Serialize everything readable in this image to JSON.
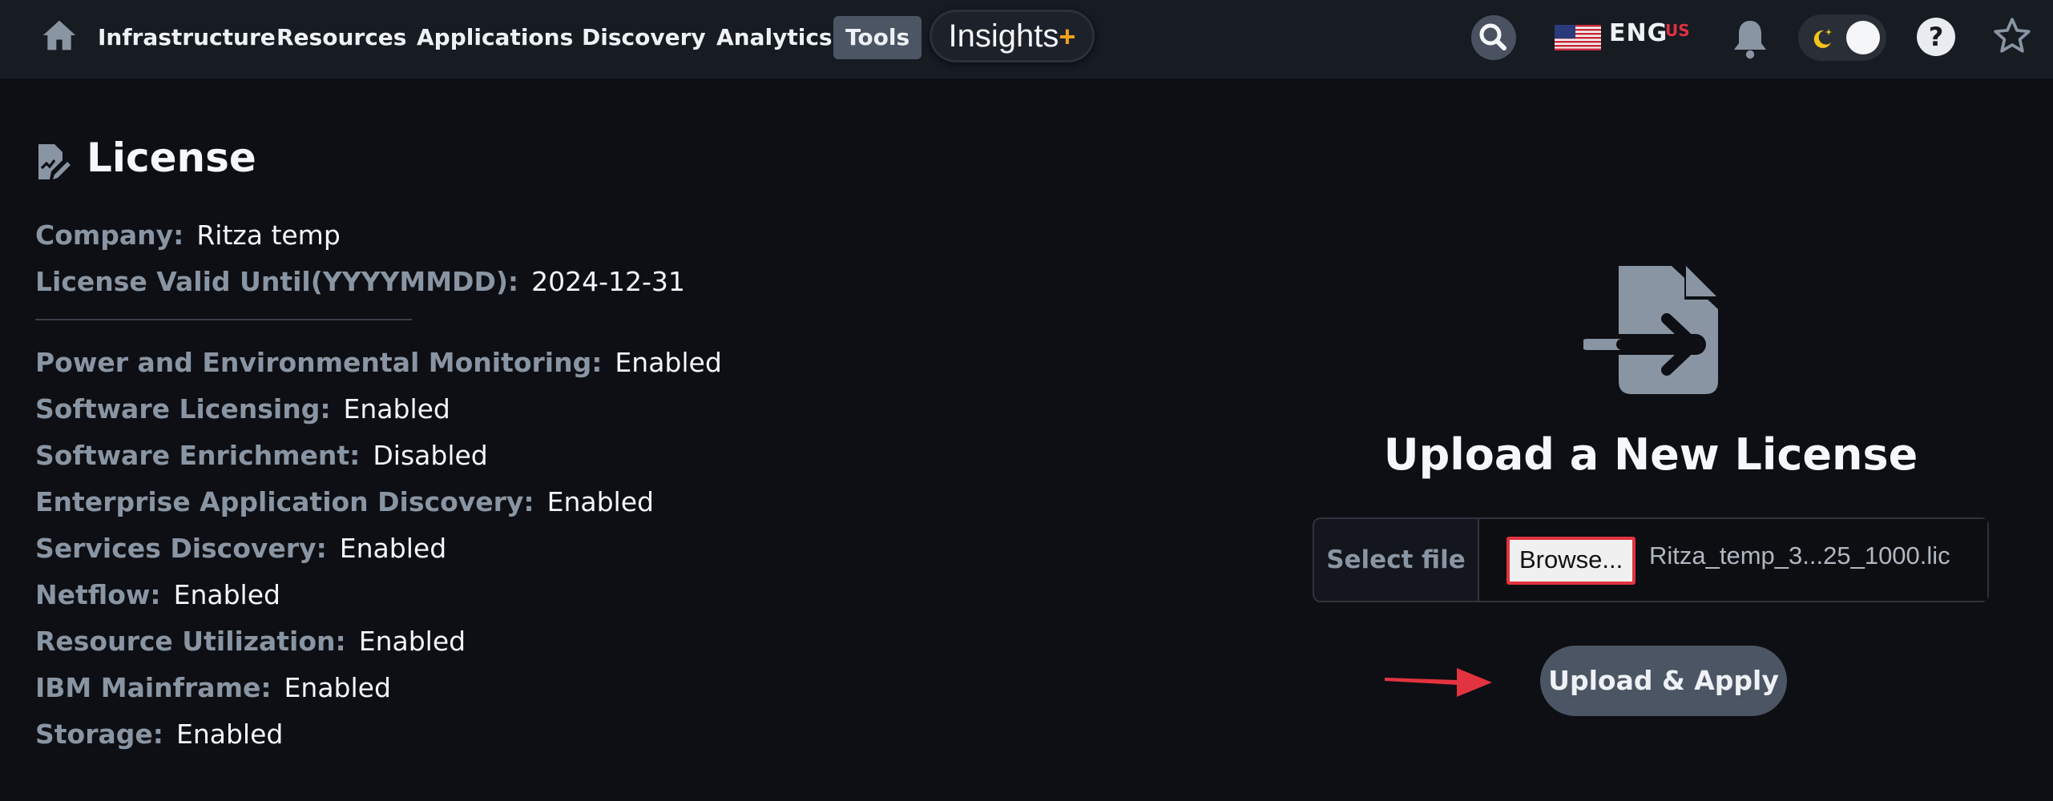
{
  "nav": {
    "items": [
      {
        "label": "Infrastructure"
      },
      {
        "label": "Resources"
      },
      {
        "label": "Applications"
      },
      {
        "label": "Discovery"
      },
      {
        "label": "Analytics"
      },
      {
        "label": "Tools",
        "active": true
      }
    ],
    "insights_label": "Insights",
    "insights_plus": "+",
    "language": "ENG",
    "language_region": "US",
    "icons": [
      "home-icon",
      "search-icon",
      "us-flag-icon",
      "bell-icon",
      "moon-icon",
      "help-icon",
      "star-icon"
    ],
    "help_glyph": "?"
  },
  "license": {
    "title": "License",
    "company_label": "Company:",
    "company_value": "Ritza temp",
    "valid_label": "License Valid Until(YYYYMMDD):",
    "valid_value": "2024-12-31",
    "features": [
      {
        "label": "Power and Environmental Monitoring:",
        "value": "Enabled"
      },
      {
        "label": "Software Licensing:",
        "value": "Enabled"
      },
      {
        "label": "Software Enrichment:",
        "value": "Disabled"
      },
      {
        "label": "Enterprise Application Discovery:",
        "value": "Enabled"
      },
      {
        "label": "Services Discovery:",
        "value": "Enabled"
      },
      {
        "label": "Netflow:",
        "value": "Enabled"
      },
      {
        "label": "Resource Utilization:",
        "value": "Enabled"
      },
      {
        "label": "IBM Mainframe:",
        "value": "Enabled"
      },
      {
        "label": "Storage:",
        "value": "Enabled"
      }
    ]
  },
  "upload": {
    "title": "Upload a New License",
    "select_label": "Select file",
    "browse_label": "Browse...",
    "file_name": "Ritza_temp_3...25_1000.lic",
    "apply_label": "Upload & Apply"
  },
  "colors": {
    "background": "#0d0f14",
    "nav_background": "#171b22",
    "label_gray": "#8a95a3",
    "highlight_red": "#e23340",
    "button_gray": "#4b5563",
    "insights_plus": "#f0a020"
  }
}
